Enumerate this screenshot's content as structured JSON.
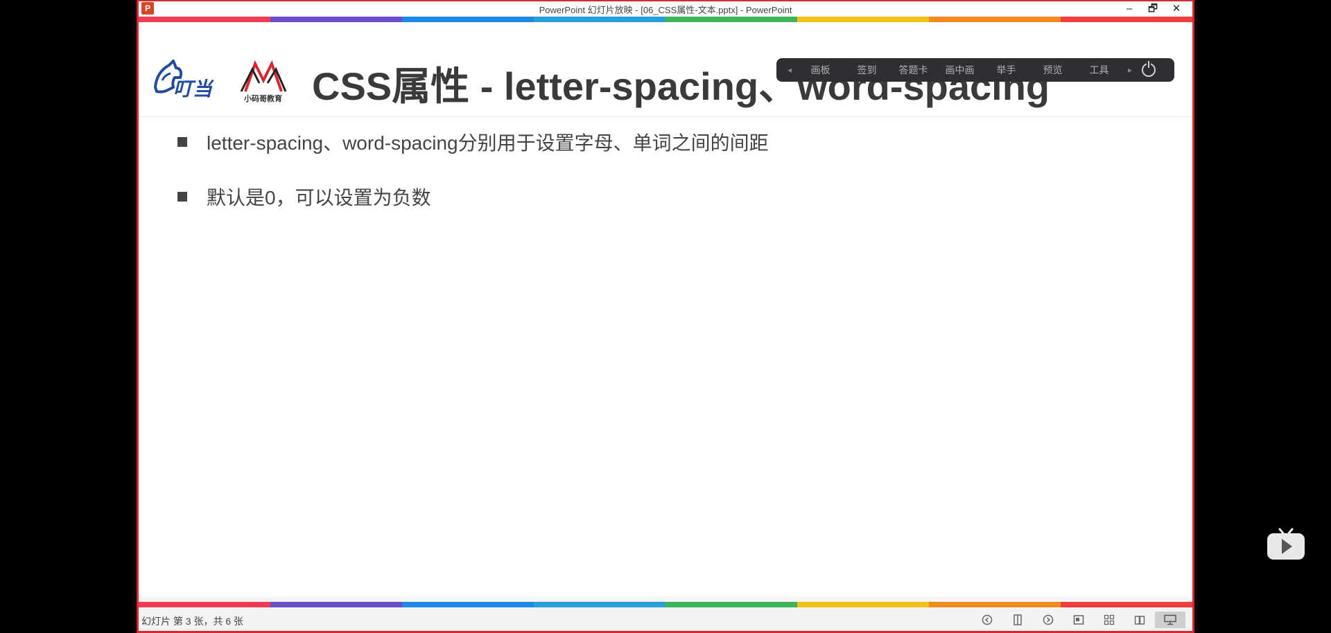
{
  "window": {
    "title": "PowerPoint 幻灯片放映 - [06_CSS属性-文本.pptx] - PowerPoint",
    "app_icon": "P",
    "minimize_label": "–",
    "restore_label": "🗗",
    "close_label": "✕"
  },
  "slide": {
    "title": "CSS属性 - letter-spacing、word-spacing",
    "bullets": [
      "letter-spacing、word-spacing分别用于设置字母、单词之间的间距",
      "默认是0，可以设置为负数"
    ],
    "logo_text": "小码哥教育"
  },
  "toolbar": {
    "left_arrow": "◂",
    "items": [
      "画板",
      "签到",
      "答题卡",
      "画中画",
      "举手",
      "预览",
      "工具"
    ],
    "right_arrow": "▸"
  },
  "status": {
    "slide_info": "幻灯片 第 3 张，共 6 张"
  },
  "colors": {
    "stripe": [
      "#f03c50",
      "#6a4fc9",
      "#1e88e5",
      "#26a0d8",
      "#3cb55a",
      "#f2c21b",
      "#f58a1f",
      "#f03c3c"
    ],
    "window_border": "#d9272e",
    "toolbar_bg": "#2f2f33"
  },
  "icons": {
    "player": "play-icon",
    "power": "power-icon"
  }
}
